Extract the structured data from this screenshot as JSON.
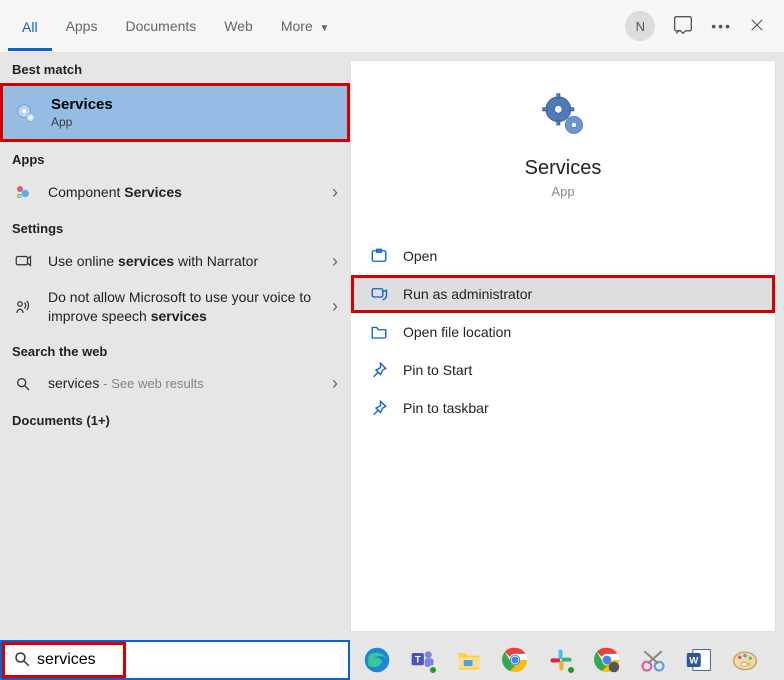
{
  "tabs": {
    "all": "All",
    "apps": "Apps",
    "documents": "Documents",
    "web": "Web",
    "more": "More"
  },
  "titlebar": {
    "avatar_letter": "N"
  },
  "left": {
    "best_match_label": "Best match",
    "best_match_item": {
      "title": "Services",
      "subtitle": "App"
    },
    "apps_label": "Apps",
    "apps_item_prefix": "Component ",
    "apps_item_bold": "Services",
    "settings_label": "Settings",
    "setting1_a": "Use online ",
    "setting1_b": "services",
    "setting1_c": " with Narrator",
    "setting2_a": "Do not allow Microsoft to use your voice to improve speech ",
    "setting2_b": "services",
    "web_label": "Search the web",
    "web_query": "services",
    "web_suffix": "See web results",
    "documents_label": "Documents (1+)"
  },
  "preview": {
    "title": "Services",
    "subtitle": "App",
    "actions": {
      "open": "Open",
      "run_admin": "Run as administrator",
      "open_loc": "Open file location",
      "pin_start": "Pin to Start",
      "pin_taskbar": "Pin to taskbar"
    }
  },
  "search": {
    "value": "services"
  }
}
